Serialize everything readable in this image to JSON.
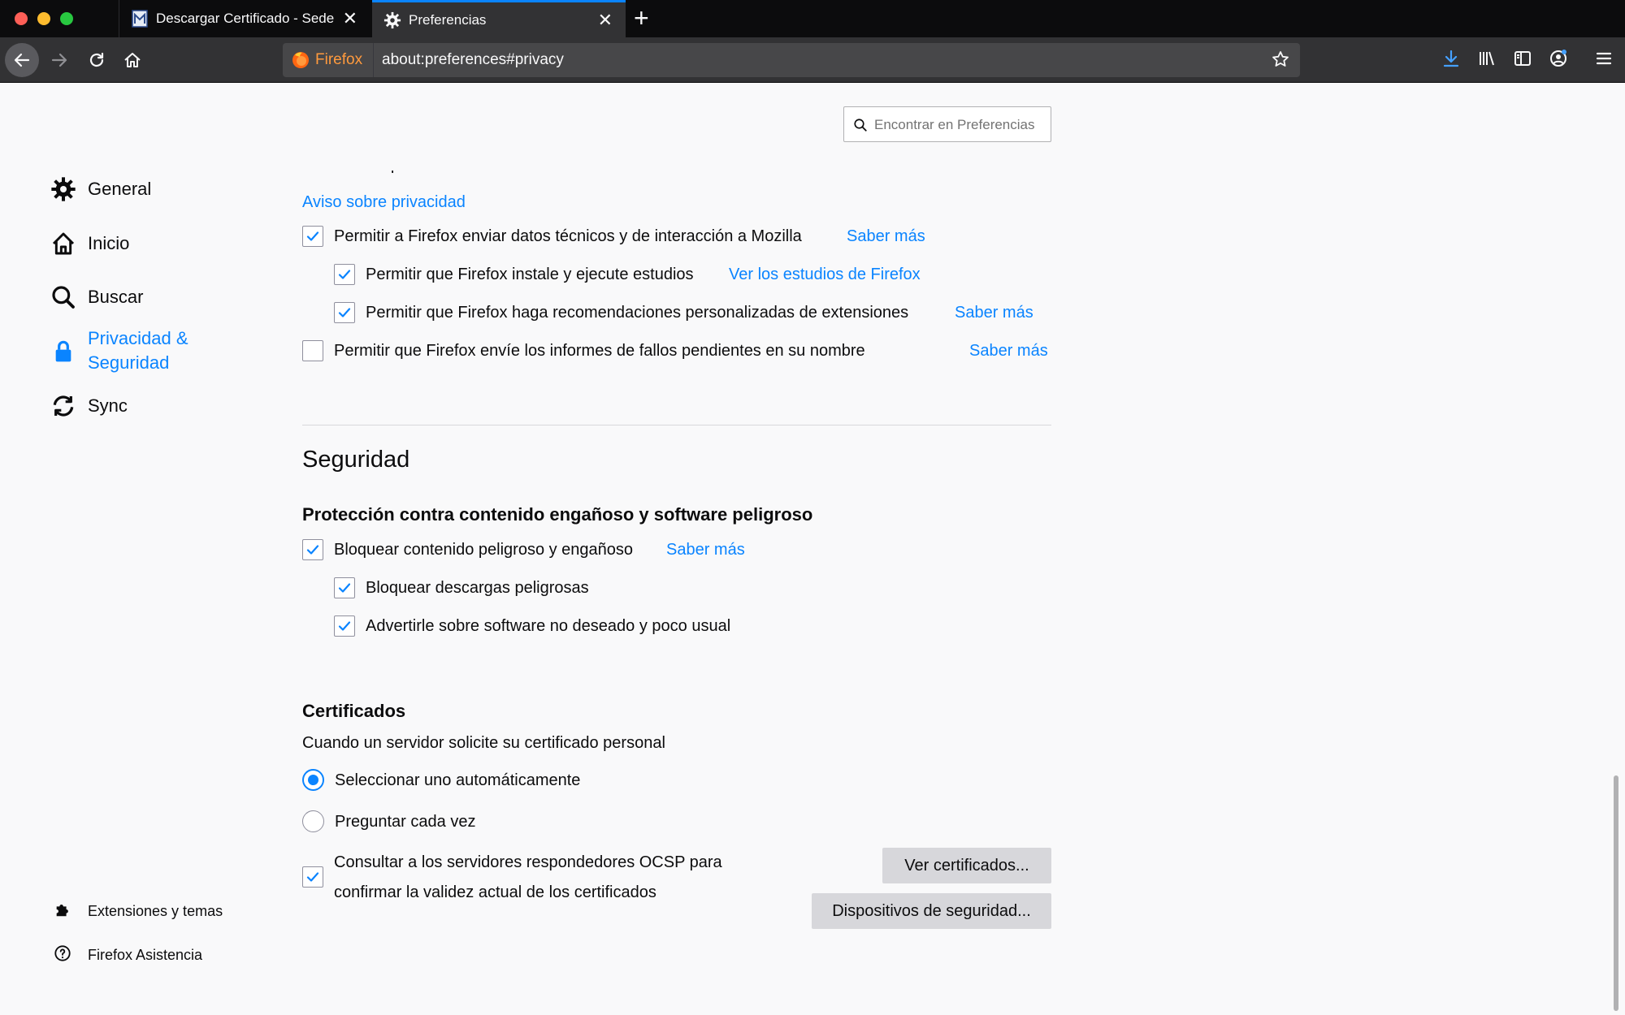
{
  "browser": {
    "tabs": [
      {
        "title": "Descargar Certificado - Sede",
        "icon": "site-favicon"
      },
      {
        "title": "Preferencias",
        "icon": "gear-icon"
      }
    ],
    "identity_label": "Firefox",
    "url": "about:preferences#privacy",
    "accent": "#0a84ff"
  },
  "search": {
    "placeholder": "Encontrar en Preferencias"
  },
  "sidebar": {
    "items": [
      {
        "label": "General",
        "icon": "gear-icon"
      },
      {
        "label": "Inicio",
        "icon": "home-icon"
      },
      {
        "label": "Buscar",
        "icon": "search-icon"
      },
      {
        "label": "Privacidad &",
        "label2": "Seguridad",
        "icon": "lock-icon",
        "selected": true
      },
      {
        "label": "Sync",
        "icon": "sync-icon"
      }
    ],
    "footer": [
      {
        "label": "Extensiones y temas",
        "icon": "puzzle-icon"
      },
      {
        "label": "Firefox Asistencia",
        "icon": "help-icon"
      }
    ]
  },
  "data_collection": {
    "partial_text": "información personal.",
    "privacy_link": "Aviso sobre privacidad",
    "options": [
      {
        "label": "Permitir a Firefox enviar datos técnicos y de interacción a Mozilla",
        "checked": true,
        "link": "Saber más"
      },
      {
        "label": "Permitir que Firefox instale y ejecute estudios",
        "checked": true,
        "link": "Ver los estudios de Firefox"
      },
      {
        "label": "Permitir que Firefox haga recomendaciones personalizadas de extensiones",
        "checked": true,
        "link": "Saber más"
      },
      {
        "label": "Permitir que Firefox envíe los informes de fallos pendientes en su nombre",
        "checked": false,
        "link": "Saber más"
      }
    ]
  },
  "security": {
    "title": "Seguridad",
    "protection_heading": "Protección contra contenido engañoso y software peligroso",
    "options": [
      {
        "label": "Bloquear contenido peligroso y engañoso",
        "checked": true,
        "link": "Saber más"
      },
      {
        "label": "Bloquear descargas peligrosas",
        "checked": true
      },
      {
        "label": "Advertirle sobre software no deseado y poco usual",
        "checked": true
      }
    ]
  },
  "certificates": {
    "heading": "Certificados",
    "description": "Cuando un servidor solicite su certificado personal",
    "radio_auto": "Seleccionar uno automáticamente",
    "radio_ask": "Preguntar cada vez",
    "selected_radio": "auto",
    "ocsp_line1": "Consultar a los servidores respondedores OCSP para",
    "ocsp_line2": "confirmar la validez actual de los certificados",
    "ocsp_checked": true,
    "view_button": "Ver certificados...",
    "devices_button": "Dispositivos de seguridad..."
  }
}
